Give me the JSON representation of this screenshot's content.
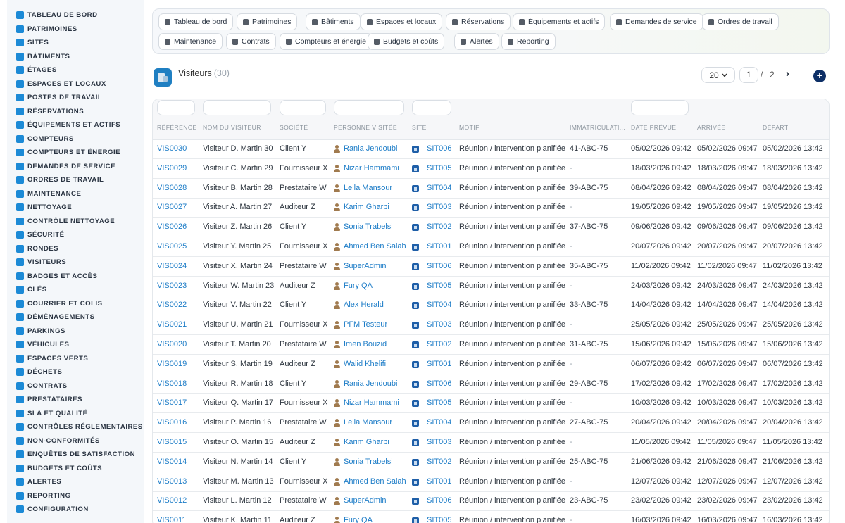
{
  "sidebar": {
    "items": [
      {
        "label": "TABLEAU DE BORD",
        "icon": "dashboard-icon"
      },
      {
        "label": "PATRIMOINES",
        "icon": "building-icon"
      },
      {
        "label": "SITES",
        "icon": "map-pin-icon"
      },
      {
        "label": "BÂTIMENTS",
        "icon": "building-icon"
      },
      {
        "label": "ÉTAGES",
        "icon": "layers-icon"
      },
      {
        "label": "ESPACES ET LOCAUX",
        "icon": "door-icon"
      },
      {
        "label": "POSTES DE TRAVAIL",
        "icon": "desktop-icon"
      },
      {
        "label": "RÉSERVATIONS",
        "icon": "calendar-icon"
      },
      {
        "label": "ÉQUIPEMENTS ET ACTIFS",
        "icon": "gears-icon"
      },
      {
        "label": "COMPTEURS",
        "icon": "gauge-icon"
      },
      {
        "label": "COMPTEURS ET ÉNERGIE",
        "icon": "bolt-icon"
      },
      {
        "label": "DEMANDES DE SERVICE",
        "icon": "file-icon"
      },
      {
        "label": "ORDRES DE TRAVAIL",
        "icon": "tools-icon"
      },
      {
        "label": "MAINTENANCE",
        "icon": "wrench-icon"
      },
      {
        "label": "NETTOYAGE",
        "icon": "broom-icon"
      },
      {
        "label": "CONTRÔLE NETTOYAGE",
        "icon": "broom-check-icon"
      },
      {
        "label": "SÉCURITÉ",
        "icon": "shield-icon"
      },
      {
        "label": "RONDES",
        "icon": "route-icon"
      },
      {
        "label": "VISITEURS",
        "icon": "id-card-icon"
      },
      {
        "label": "BADGES ET ACCÈS",
        "icon": "badge-icon"
      },
      {
        "label": "CLÉS",
        "icon": "key-icon"
      },
      {
        "label": "COURRIER ET COLIS",
        "icon": "mail-icon"
      },
      {
        "label": "DÉMÉNAGEMENTS",
        "icon": "dolly-icon"
      },
      {
        "label": "PARKINGS",
        "icon": "parking-icon"
      },
      {
        "label": "VÉHICULES",
        "icon": "car-icon"
      },
      {
        "label": "ESPACES VERTS",
        "icon": "leaf-icon"
      },
      {
        "label": "DÉCHETS",
        "icon": "trash-icon"
      },
      {
        "label": "CONTRATS",
        "icon": "contract-icon"
      },
      {
        "label": "PRESTATAIRES",
        "icon": "handshake-icon"
      },
      {
        "label": "SLA ET QUALITÉ",
        "icon": "quality-icon"
      },
      {
        "label": "CONTRÔLES RÉGLEMENTAIRES",
        "icon": "checklist-icon"
      },
      {
        "label": "NON-CONFORMITÉS",
        "icon": "warning-icon"
      },
      {
        "label": "ENQUÊTES DE SATISFACTION",
        "icon": "star-icon"
      },
      {
        "label": "BUDGETS ET COÛTS",
        "icon": "coins-icon"
      },
      {
        "label": "ALERTES",
        "icon": "bell-icon"
      },
      {
        "label": "REPORTING",
        "icon": "chart-icon"
      },
      {
        "label": "CONFIGURATION",
        "icon": "gear-icon"
      }
    ]
  },
  "modules": [
    {
      "label": "Tableau de bord",
      "icon": "dashboard-icon"
    },
    {
      "label": "Patrimoines",
      "icon": "building-icon"
    },
    {
      "label": "Bâtiments",
      "icon": "building-icon"
    },
    {
      "label": "Espaces et locaux",
      "icon": "door-icon"
    },
    {
      "label": "Réservations",
      "icon": "calendar-icon"
    },
    {
      "label": "Équipements et actifs",
      "icon": "gears-icon"
    },
    {
      "label": "Demandes de service",
      "icon": "file-icon"
    },
    {
      "label": "Ordres de travail",
      "icon": "tools-icon"
    },
    {
      "label": "Maintenance",
      "icon": "wrench-icon"
    },
    {
      "label": "Contrats",
      "icon": "contract-icon"
    },
    {
      "label": "Compteurs et énergie",
      "icon": "bolt-icon"
    },
    {
      "label": "Budgets et coûts",
      "icon": "coins-icon"
    },
    {
      "label": "Alertes",
      "icon": "bell-icon"
    },
    {
      "label": "Reporting",
      "icon": "chart-icon"
    }
  ],
  "header": {
    "title": "Visiteurs",
    "count": "(30)",
    "page_size": "20",
    "page_current": "1",
    "page_separator": "/",
    "page_total": "2",
    "next_icon": "›",
    "add_icon": "+"
  },
  "table": {
    "columns": [
      "RÉFÉRENCE",
      "NOM DU VISITEUR",
      "SOCIÉTÉ",
      "PERSONNE VISITÉE",
      "SITE",
      "MOTIF",
      "IMMATRICULATI...",
      "DATE PRÉVUE",
      "ARRIVÉE",
      "DÉPART"
    ],
    "rows": [
      [
        "VIS0030",
        "Visiteur D. Martin 30",
        "Client Y",
        "Rania Jendoubi",
        "SIT006",
        "Réunion / intervention planifiée",
        "41-ABC-75",
        "05/02/2026 09:42",
        "05/02/2026 09:47",
        "05/02/2026 13:42"
      ],
      [
        "VIS0029",
        "Visiteur C. Martin 29",
        "Fournisseur X",
        "Nizar Hammami",
        "SIT005",
        "Réunion / intervention planifiée",
        "-",
        "18/03/2026 09:42",
        "18/03/2026 09:47",
        "18/03/2026 13:42"
      ],
      [
        "VIS0028",
        "Visiteur B. Martin 28",
        "Prestataire W",
        "Leila Mansour",
        "SIT004",
        "Réunion / intervention planifiée",
        "39-ABC-75",
        "08/04/2026 09:42",
        "08/04/2026 09:47",
        "08/04/2026 13:42"
      ],
      [
        "VIS0027",
        "Visiteur A. Martin 27",
        "Auditeur Z",
        "Karim Gharbi",
        "SIT003",
        "Réunion / intervention planifiée",
        "-",
        "19/05/2026 09:42",
        "19/05/2026 09:47",
        "19/05/2026 13:42"
      ],
      [
        "VIS0026",
        "Visiteur Z. Martin 26",
        "Client Y",
        "Sonia Trabelsi",
        "SIT002",
        "Réunion / intervention planifiée",
        "37-ABC-75",
        "09/06/2026 09:42",
        "09/06/2026 09:47",
        "09/06/2026 13:42"
      ],
      [
        "VIS0025",
        "Visiteur Y. Martin 25",
        "Fournisseur X",
        "Ahmed Ben Salah",
        "SIT001",
        "Réunion / intervention planifiée",
        "-",
        "20/07/2026 09:42",
        "20/07/2026 09:47",
        "20/07/2026 13:42"
      ],
      [
        "VIS0024",
        "Visiteur X. Martin 24",
        "Prestataire W",
        "SuperAdmin",
        "SIT006",
        "Réunion / intervention planifiée",
        "35-ABC-75",
        "11/02/2026 09:42",
        "11/02/2026 09:47",
        "11/02/2026 13:42"
      ],
      [
        "VIS0023",
        "Visiteur W. Martin 23",
        "Auditeur Z",
        "Fury QA",
        "SIT005",
        "Réunion / intervention planifiée",
        "-",
        "24/03/2026 09:42",
        "24/03/2026 09:47",
        "24/03/2026 13:42"
      ],
      [
        "VIS0022",
        "Visiteur V. Martin 22",
        "Client Y",
        "Alex Herald",
        "SIT004",
        "Réunion / intervention planifiée",
        "33-ABC-75",
        "14/04/2026 09:42",
        "14/04/2026 09:47",
        "14/04/2026 13:42"
      ],
      [
        "VIS0021",
        "Visiteur U. Martin 21",
        "Fournisseur X",
        "PFM Testeur",
        "SIT003",
        "Réunion / intervention planifiée",
        "-",
        "25/05/2026 09:42",
        "25/05/2026 09:47",
        "25/05/2026 13:42"
      ],
      [
        "VIS0020",
        "Visiteur T. Martin 20",
        "Prestataire W",
        "Imen Bouzid",
        "SIT002",
        "Réunion / intervention planifiée",
        "31-ABC-75",
        "15/06/2026 09:42",
        "15/06/2026 09:47",
        "15/06/2026 13:42"
      ],
      [
        "VIS0019",
        "Visiteur S. Martin 19",
        "Auditeur Z",
        "Walid Khelifi",
        "SIT001",
        "Réunion / intervention planifiée",
        "-",
        "06/07/2026 09:42",
        "06/07/2026 09:47",
        "06/07/2026 13:42"
      ],
      [
        "VIS0018",
        "Visiteur R. Martin 18",
        "Client Y",
        "Rania Jendoubi",
        "SIT006",
        "Réunion / intervention planifiée",
        "29-ABC-75",
        "17/02/2026 09:42",
        "17/02/2026 09:47",
        "17/02/2026 13:42"
      ],
      [
        "VIS0017",
        "Visiteur Q. Martin 17",
        "Fournisseur X",
        "Nizar Hammami",
        "SIT005",
        "Réunion / intervention planifiée",
        "-",
        "10/03/2026 09:42",
        "10/03/2026 09:47",
        "10/03/2026 13:42"
      ],
      [
        "VIS0016",
        "Visiteur P. Martin 16",
        "Prestataire W",
        "Leila Mansour",
        "SIT004",
        "Réunion / intervention planifiée",
        "27-ABC-75",
        "20/04/2026 09:42",
        "20/04/2026 09:47",
        "20/04/2026 13:42"
      ],
      [
        "VIS0015",
        "Visiteur O. Martin 15",
        "Auditeur Z",
        "Karim Gharbi",
        "SIT003",
        "Réunion / intervention planifiée",
        "-",
        "11/05/2026 09:42",
        "11/05/2026 09:47",
        "11/05/2026 13:42"
      ],
      [
        "VIS0014",
        "Visiteur N. Martin 14",
        "Client Y",
        "Sonia Trabelsi",
        "SIT002",
        "Réunion / intervention planifiée",
        "25-ABC-75",
        "21/06/2026 09:42",
        "21/06/2026 09:47",
        "21/06/2026 13:42"
      ],
      [
        "VIS0013",
        "Visiteur M. Martin 13",
        "Fournisseur X",
        "Ahmed Ben Salah",
        "SIT001",
        "Réunion / intervention planifiée",
        "-",
        "12/07/2026 09:42",
        "12/07/2026 09:47",
        "12/07/2026 13:42"
      ],
      [
        "VIS0012",
        "Visiteur L. Martin 12",
        "Prestataire W",
        "SuperAdmin",
        "SIT006",
        "Réunion / intervention planifiée",
        "23-ABC-75",
        "23/02/2026 09:42",
        "23/02/2026 09:47",
        "23/02/2026 13:42"
      ],
      [
        "VIS0011",
        "Visiteur K. Martin 11",
        "Auditeur Z",
        "Fury QA",
        "SIT005",
        "Réunion / intervention planifiée",
        "-",
        "16/03/2026 09:42",
        "16/03/2026 09:47",
        "16/03/2026 13:42"
      ]
    ]
  },
  "colors": {
    "accent": "#1c7cc7",
    "sidebar_bg": "#f4f7fa",
    "add_button": "#0d2f66",
    "person_icon": "#a07a4e"
  }
}
